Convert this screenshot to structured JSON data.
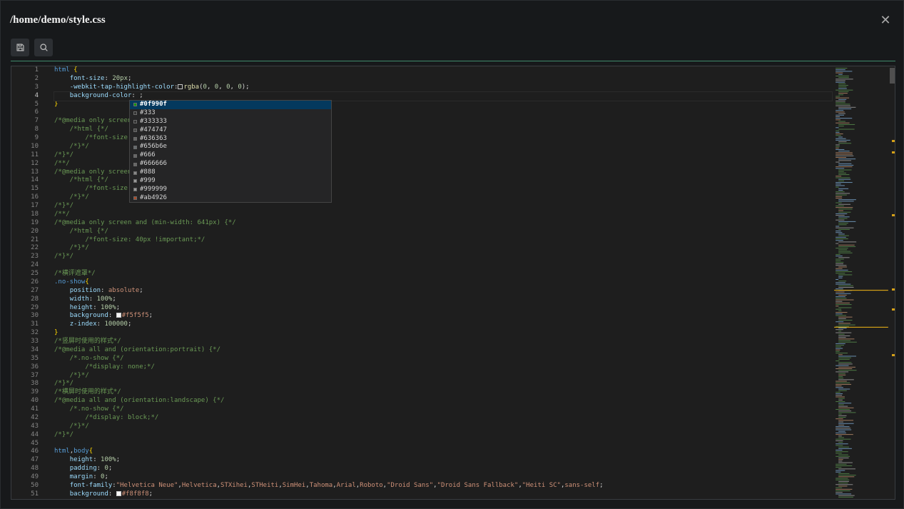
{
  "window": {
    "title": "/home/demo/style.css"
  },
  "toolbar": {
    "save_icon": "save-icon",
    "search_icon": "search-icon"
  },
  "editor": {
    "active_line": 4,
    "lines": [
      [
        [
          "sel",
          "html "
        ],
        [
          "br",
          "{"
        ]
      ],
      [
        [
          "p",
          "    "
        ],
        [
          "prop",
          "font-size"
        ],
        [
          "p",
          ": "
        ],
        [
          "num",
          "20px"
        ],
        [
          "p",
          ";"
        ]
      ],
      [
        [
          "p",
          "    "
        ],
        [
          "prop",
          "-webkit-tap-highlight-color"
        ],
        [
          "p",
          ":"
        ],
        [
          "sw",
          "transparent"
        ],
        [
          "fn",
          "rgba"
        ],
        [
          "p",
          "("
        ],
        [
          "num",
          "0"
        ],
        [
          "p",
          ", "
        ],
        [
          "num",
          "0"
        ],
        [
          "p",
          ", "
        ],
        [
          "num",
          "0"
        ],
        [
          "p",
          ", "
        ],
        [
          "num",
          "0"
        ],
        [
          "p",
          ");"
        ]
      ],
      [
        [
          "p",
          "    "
        ],
        [
          "prop",
          "background-color"
        ],
        [
          "p",
          ": ;"
        ]
      ],
      [
        [
          "br",
          "}"
        ]
      ],
      [
        [
          "p",
          ""
        ]
      ],
      [
        [
          "cm",
          "/*@media only screen a"
        ]
      ],
      [
        [
          "cm",
          "    /*html {*/"
        ]
      ],
      [
        [
          "cm",
          "        /*font-size: 3"
        ]
      ],
      [
        [
          "cm",
          "    /*}*/"
        ]
      ],
      [
        [
          "cm",
          "/*}*/"
        ]
      ],
      [
        [
          "cm",
          "/**/"
        ]
      ],
      [
        [
          "cm",
          "/*@media only screen a"
        ]
      ],
      [
        [
          "cm",
          "    /*html {*/"
        ]
      ],
      [
        [
          "cm",
          "        /*font-size: 3"
        ]
      ],
      [
        [
          "cm",
          "    /*}*/"
        ]
      ],
      [
        [
          "cm",
          "/*}*/"
        ]
      ],
      [
        [
          "cm",
          "/**/"
        ]
      ],
      [
        [
          "cm",
          "/*@media only screen and (min-width: 641px) {*/"
        ]
      ],
      [
        [
          "cm",
          "    /*html {*/"
        ]
      ],
      [
        [
          "cm",
          "        /*font-size: 40px !important;*/"
        ]
      ],
      [
        [
          "cm",
          "    /*}*/"
        ]
      ],
      [
        [
          "cm",
          "/*}*/"
        ]
      ],
      [
        [
          "p",
          ""
        ]
      ],
      [
        [
          "cm",
          "/*横评遮罩*/"
        ]
      ],
      [
        [
          "sel",
          ".no-show"
        ],
        [
          "br",
          "{"
        ]
      ],
      [
        [
          "p",
          "    "
        ],
        [
          "prop",
          "position"
        ],
        [
          "p",
          ": "
        ],
        [
          "val",
          "absolute"
        ],
        [
          "p",
          ";"
        ]
      ],
      [
        [
          "p",
          "    "
        ],
        [
          "prop",
          "width"
        ],
        [
          "p",
          ": "
        ],
        [
          "num",
          "100%"
        ],
        [
          "p",
          ";"
        ]
      ],
      [
        [
          "p",
          "    "
        ],
        [
          "prop",
          "height"
        ],
        [
          "p",
          ": "
        ],
        [
          "num",
          "100%"
        ],
        [
          "p",
          ";"
        ]
      ],
      [
        [
          "p",
          "    "
        ],
        [
          "prop",
          "background"
        ],
        [
          "p",
          ": "
        ],
        [
          "sw",
          "#f5f5f5"
        ],
        [
          "val",
          "#f5f5f5"
        ],
        [
          "p",
          ";"
        ]
      ],
      [
        [
          "p",
          "    "
        ],
        [
          "prop",
          "z-index"
        ],
        [
          "p",
          ": "
        ],
        [
          "num",
          "100000"
        ],
        [
          "p",
          ";"
        ]
      ],
      [
        [
          "br",
          "}"
        ]
      ],
      [
        [
          "cm",
          "/*竖屏时使用的样式*/"
        ]
      ],
      [
        [
          "cm",
          "/*@media all and (orientation:portrait) {*/"
        ]
      ],
      [
        [
          "cm",
          "    /*.no-show {*/"
        ]
      ],
      [
        [
          "cm",
          "        /*display: none;*/"
        ]
      ],
      [
        [
          "cm",
          "    /*}*/"
        ]
      ],
      [
        [
          "cm",
          "/*}*/"
        ]
      ],
      [
        [
          "cm",
          "/*横屏时使用的样式*/"
        ]
      ],
      [
        [
          "cm",
          "/*@media all and (orientation:landscape) {*/"
        ]
      ],
      [
        [
          "cm",
          "    /*.no-show {*/"
        ]
      ],
      [
        [
          "cm",
          "        /*display: block;*/"
        ]
      ],
      [
        [
          "cm",
          "    /*}*/"
        ]
      ],
      [
        [
          "cm",
          "/*}*/"
        ]
      ],
      [
        [
          "p",
          ""
        ]
      ],
      [
        [
          "sel",
          "html"
        ],
        [
          "p",
          ","
        ],
        [
          "sel",
          "body"
        ],
        [
          "br",
          "{"
        ]
      ],
      [
        [
          "p",
          "    "
        ],
        [
          "prop",
          "height"
        ],
        [
          "p",
          ": "
        ],
        [
          "num",
          "100%"
        ],
        [
          "p",
          ";"
        ]
      ],
      [
        [
          "p",
          "    "
        ],
        [
          "prop",
          "padding"
        ],
        [
          "p",
          ": "
        ],
        [
          "num",
          "0"
        ],
        [
          "p",
          ";"
        ]
      ],
      [
        [
          "p",
          "    "
        ],
        [
          "prop",
          "margin"
        ],
        [
          "p",
          ": "
        ],
        [
          "num",
          "0"
        ],
        [
          "p",
          ";"
        ]
      ],
      [
        [
          "p",
          "    "
        ],
        [
          "prop",
          "font-family"
        ],
        [
          "p",
          ":"
        ],
        [
          "val",
          "\"Helvetica Neue\""
        ],
        [
          "p",
          ","
        ],
        [
          "val",
          "Helvetica"
        ],
        [
          "p",
          ","
        ],
        [
          "val",
          "STXihei"
        ],
        [
          "p",
          ","
        ],
        [
          "val",
          "STHeiti"
        ],
        [
          "p",
          ","
        ],
        [
          "val",
          "SimHei"
        ],
        [
          "p",
          ","
        ],
        [
          "val",
          "Tahoma"
        ],
        [
          "p",
          ","
        ],
        [
          "val",
          "Arial"
        ],
        [
          "p",
          ","
        ],
        [
          "val",
          "Roboto"
        ],
        [
          "p",
          ","
        ],
        [
          "val",
          "\"Droid Sans\""
        ],
        [
          "p",
          ","
        ],
        [
          "val",
          "\"Droid Sans Fallback\""
        ],
        [
          "p",
          ","
        ],
        [
          "val",
          "\"Heiti SC\""
        ],
        [
          "p",
          ","
        ],
        [
          "val",
          "sans-self"
        ],
        [
          "p",
          ";"
        ]
      ],
      [
        [
          "p",
          "    "
        ],
        [
          "prop",
          "background"
        ],
        [
          "p",
          ": "
        ],
        [
          "sw",
          "#f8f8f8"
        ],
        [
          "val",
          "#f8f8f8"
        ],
        [
          "p",
          ";"
        ]
      ]
    ]
  },
  "suggest": {
    "selected": 0,
    "items": [
      {
        "label": "#0f990f",
        "color": "#0f990f"
      },
      {
        "label": "#333",
        "color": "#333333"
      },
      {
        "label": "#333333",
        "color": "#333333"
      },
      {
        "label": "#474747",
        "color": "#474747"
      },
      {
        "label": "#636363",
        "color": "#636363"
      },
      {
        "label": "#656b6e",
        "color": "#656b6e"
      },
      {
        "label": "#666",
        "color": "#666666"
      },
      {
        "label": "#666666",
        "color": "#666666"
      },
      {
        "label": "#888",
        "color": "#888888"
      },
      {
        "label": "#999",
        "color": "#999999"
      },
      {
        "label": "#999999",
        "color": "#999999"
      },
      {
        "label": "#ab4926",
        "color": "#ab4926"
      }
    ]
  },
  "colors": {
    "accent": "#3f8a6a",
    "selection": "#04395e",
    "marker": "#d4a017"
  }
}
